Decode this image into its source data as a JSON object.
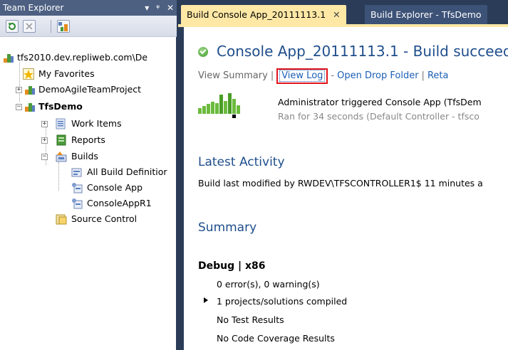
{
  "team_explorer": {
    "title": "Team Explorer",
    "pin_glyph": "▾ ⊓ ✕",
    "tree": {
      "server": "tfs2010.dev.repliweb.com\\De",
      "favorites": "My Favorites",
      "project1": "DemoAgileTeamProject",
      "project2": "TfsDemo",
      "work_items": "Work Items",
      "reports": "Reports",
      "builds": "Builds",
      "all_builds": "All Build Definitior",
      "console_app": "Console App",
      "console_app_r1": "ConsoleAppR1",
      "source_control": "Source Control"
    }
  },
  "tabs": {
    "active": "Build Console App_20111113.1",
    "inactive": "Build Explorer - TfsDemo",
    "close_glyph": "✕"
  },
  "build": {
    "title": "Console App_20111113.1 - Build succeed",
    "actions": {
      "view_summary": "View Summary",
      "view_log": "View Log",
      "open_drop_folder": "Open Drop Folder",
      "retain": "Reta"
    },
    "trigger_text": "Administrator triggered Console App (TfsDem",
    "ran_text": "Ran for 34 seconds (Default Controller - tfsco",
    "history_bars": [
      0.25,
      0.35,
      0.45,
      0.55,
      0.5,
      0.9,
      0.6,
      0.95,
      0.7,
      0.4
    ],
    "history_bar_selected_index": 8
  },
  "latest_activity": {
    "heading": "Latest Activity",
    "text": "Build last modified by RWDEV\\TFSCONTROLLER1$ 11 minutes a"
  },
  "summary": {
    "heading": "Summary",
    "config": "Debug | x86",
    "errors": "0 error(s), 0 warning(s)",
    "compiled": "1 projects/solutions compiled",
    "tests": "No Test Results",
    "coverage": "No Code Coverage Results"
  },
  "colors": {
    "title_blue": "#1f4e8c",
    "link_blue": "#1b5fb5",
    "highlight_red": "#e2141a",
    "success_green": "#3e9a2a",
    "vs_chrome": "#2b3c59",
    "active_tab": "#ffe8a6"
  }
}
